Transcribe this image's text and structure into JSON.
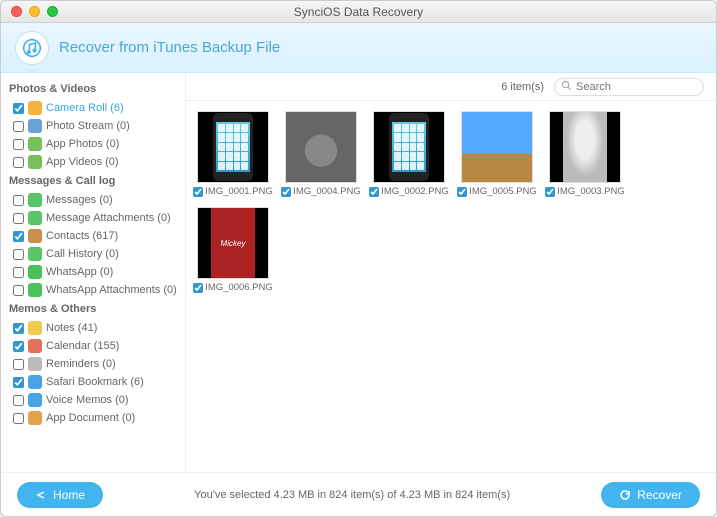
{
  "window": {
    "title": "SynciOS Data Recovery"
  },
  "header": {
    "title": "Recover from iTunes Backup File"
  },
  "sidebar": {
    "sections": [
      {
        "title": "Photos & Videos",
        "items": [
          {
            "label": "Camera Roll (6)",
            "checked": true,
            "selected": true,
            "iconColor": "#f7b13c"
          },
          {
            "label": "Photo Stream (0)",
            "checked": false,
            "selected": false,
            "iconColor": "#6aa2d8"
          },
          {
            "label": "App Photos (0)",
            "checked": false,
            "selected": false,
            "iconColor": "#7bbf5a"
          },
          {
            "label": "App Videos (0)",
            "checked": false,
            "selected": false,
            "iconColor": "#7bbf5a"
          }
        ]
      },
      {
        "title": "Messages & Call log",
        "items": [
          {
            "label": "Messages (0)",
            "checked": false,
            "selected": false,
            "iconColor": "#5bc36a"
          },
          {
            "label": "Message Attachments (0)",
            "checked": false,
            "selected": false,
            "iconColor": "#5bc36a"
          },
          {
            "label": "Contacts (617)",
            "checked": true,
            "selected": false,
            "iconColor": "#c98f4b"
          },
          {
            "label": "Call History (0)",
            "checked": false,
            "selected": false,
            "iconColor": "#5bc36a"
          },
          {
            "label": "WhatsApp (0)",
            "checked": false,
            "selected": false,
            "iconColor": "#4ac15b"
          },
          {
            "label": "WhatsApp Attachments (0)",
            "checked": false,
            "selected": false,
            "iconColor": "#4ac15b"
          }
        ]
      },
      {
        "title": "Memos & Others",
        "items": [
          {
            "label": "Notes (41)",
            "checked": true,
            "selected": false,
            "iconColor": "#f0c94e"
          },
          {
            "label": "Calendar (155)",
            "checked": true,
            "selected": false,
            "iconColor": "#e86f5c"
          },
          {
            "label": "Reminders (0)",
            "checked": false,
            "selected": false,
            "iconColor": "#bbbbbb"
          },
          {
            "label": "Safari Bookmark (6)",
            "checked": true,
            "selected": false,
            "iconColor": "#4aa3e3"
          },
          {
            "label": "Voice Memos (0)",
            "checked": false,
            "selected": false,
            "iconColor": "#4aa3e3"
          },
          {
            "label": "App Document (0)",
            "checked": false,
            "selected": false,
            "iconColor": "#e3a24a"
          }
        ]
      }
    ]
  },
  "toolbar": {
    "count_label": "6 item(s)",
    "search_placeholder": "Search"
  },
  "grid": {
    "items": [
      {
        "label": "IMG_0001.PNG",
        "checked": true,
        "kind": "iphone"
      },
      {
        "label": "IMG_0004.PNG",
        "checked": true,
        "kind": "koala"
      },
      {
        "label": "IMG_0002.PNG",
        "checked": true,
        "kind": "iphone"
      },
      {
        "label": "IMG_0005.PNG",
        "checked": true,
        "kind": "photo"
      },
      {
        "label": "IMG_0003.PNG",
        "checked": true,
        "kind": "totoro"
      },
      {
        "label": "IMG_0006.PNG",
        "checked": true,
        "kind": "mickey"
      }
    ]
  },
  "footer": {
    "status": "You've selected 4.23 MB in 824 item(s) of 4.23 MB in 824 item(s)",
    "home_label": "Home",
    "recover_label": "Recover"
  }
}
